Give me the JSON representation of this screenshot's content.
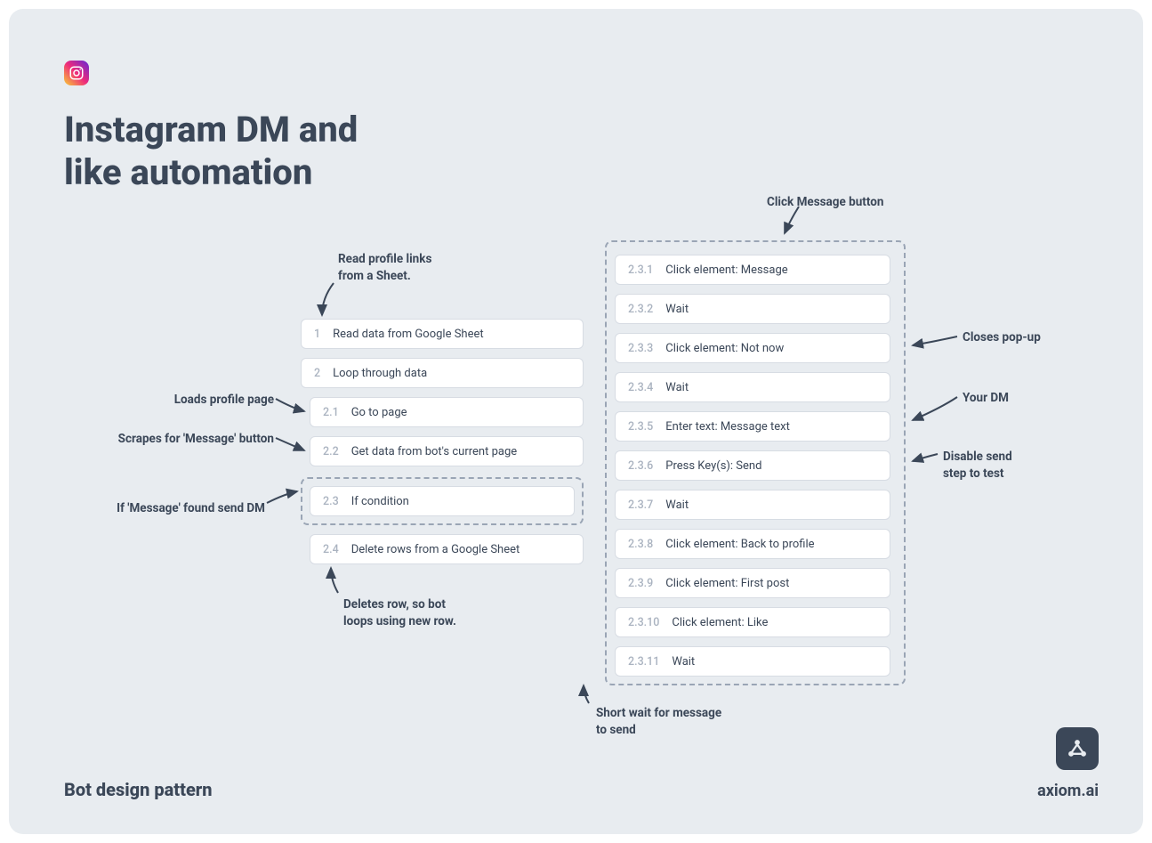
{
  "title_line1": "Instagram DM and",
  "title_line2": "like automation",
  "footer_left": "Bot design pattern",
  "footer_right": "axiom.ai",
  "left_steps": [
    {
      "num": "1",
      "label": "Read data from Google Sheet"
    },
    {
      "num": "2",
      "label": "Loop through data"
    },
    {
      "num": "2.1",
      "label": "Go to page"
    },
    {
      "num": "2.2",
      "label": "Get data from bot's current page"
    },
    {
      "num": "2.3",
      "label": "If condition"
    },
    {
      "num": "2.4",
      "label": "Delete rows from a Google Sheet"
    }
  ],
  "right_steps": [
    {
      "num": "2.3.1",
      "label": "Click element: Message"
    },
    {
      "num": "2.3.2",
      "label": "Wait"
    },
    {
      "num": "2.3.3",
      "label": "Click element: Not now"
    },
    {
      "num": "2.3.4",
      "label": "Wait"
    },
    {
      "num": "2.3.5",
      "label": "Enter text: Message text"
    },
    {
      "num": "2.3.6",
      "label": "Press Key(s): Send"
    },
    {
      "num": "2.3.7",
      "label": "Wait"
    },
    {
      "num": "2.3.8",
      "label": "Click element: Back to profile"
    },
    {
      "num": "2.3.9",
      "label": "Click element: First post"
    },
    {
      "num": "2.3.10",
      "label": "Click element: Like"
    },
    {
      "num": "2.3.11",
      "label": "Wait"
    }
  ],
  "annotations": {
    "read_links": "Read profile links\nfrom a Sheet.",
    "loads_profile": "Loads profile page",
    "scrapes": "Scrapes for 'Message' button",
    "if_found": "If 'Message' found send DM",
    "deletes": "Deletes row, so bot\nloops using new row.",
    "click_msg": "Click Message button",
    "closes_popup": "Closes pop-up",
    "your_dm": "Your DM",
    "disable_send": "Disable send\nstep to test",
    "short_wait": "Short wait for message\nto send"
  }
}
